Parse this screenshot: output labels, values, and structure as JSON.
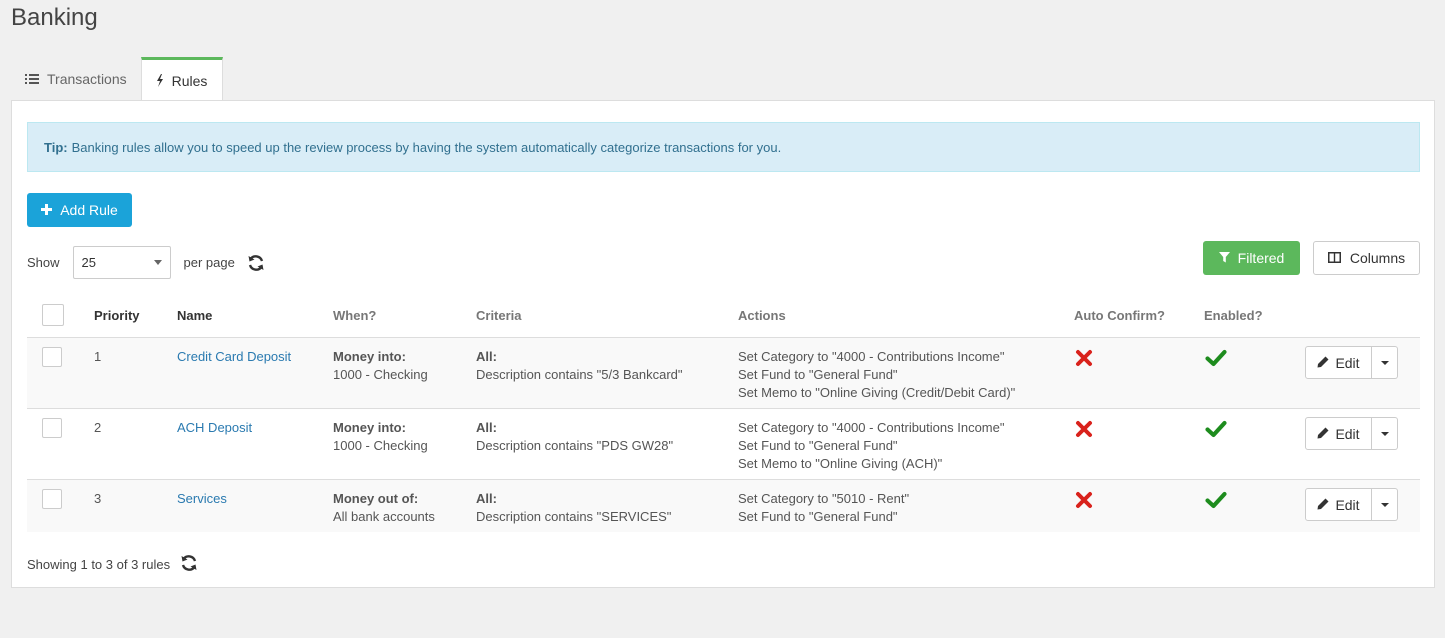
{
  "page": {
    "title": "Banking"
  },
  "tabs": [
    {
      "label": "Transactions",
      "icon": "list-icon",
      "active": false
    },
    {
      "label": "Rules",
      "icon": "bolt-icon",
      "active": true
    }
  ],
  "colors": {
    "accent": "#1ba3d9",
    "success": "#5cb85c",
    "danger": "#d9221c",
    "check": "#1e8c1e",
    "link": "#2a7ab0"
  },
  "tip": {
    "label": "Tip:",
    "text": "Banking rules allow you to speed up the review process by having the system automatically categorize transactions for you."
  },
  "toolbar": {
    "add_label": "Add Rule",
    "show_label": "Show",
    "per_page_value": "25",
    "per_page_label": "per page",
    "filtered_label": "Filtered",
    "columns_label": "Columns"
  },
  "table": {
    "headers": {
      "priority": "Priority",
      "name": "Name",
      "when": "When?",
      "criteria": "Criteria",
      "actions": "Actions",
      "auto_confirm": "Auto Confirm?",
      "enabled": "Enabled?"
    },
    "rows": [
      {
        "priority": "1",
        "name": "Credit Card Deposit",
        "when_title": "Money into:",
        "when_value": "1000 - Checking",
        "criteria_title": "All:",
        "criteria_value": "Description contains \"5/3 Bankcard\"",
        "actions": [
          "Set Category to \"4000 - Contributions Income\"",
          "Set Fund to \"General Fund\"",
          "Set Memo to \"Online Giving (Credit/Debit Card)\""
        ],
        "auto_confirm": false,
        "enabled": true,
        "edit_label": "Edit"
      },
      {
        "priority": "2",
        "name": "ACH Deposit",
        "when_title": "Money into:",
        "when_value": "1000 - Checking",
        "criteria_title": "All:",
        "criteria_value": "Description contains \"PDS GW28\"",
        "actions": [
          "Set Category to \"4000 - Contributions Income\"",
          "Set Fund to \"General Fund\"",
          "Set Memo to \"Online Giving (ACH)\""
        ],
        "auto_confirm": false,
        "enabled": true,
        "edit_label": "Edit"
      },
      {
        "priority": "3",
        "name": "Services",
        "when_title": "Money out of:",
        "when_value": "All bank accounts",
        "criteria_title": "All:",
        "criteria_value": "Description contains \"SERVICES\"",
        "actions": [
          "Set Category to \"5010 - Rent\"",
          "Set Fund to \"General Fund\""
        ],
        "auto_confirm": false,
        "enabled": true,
        "edit_label": "Edit"
      }
    ]
  },
  "footer": {
    "summary": "Showing 1 to 3 of 3 rules"
  }
}
